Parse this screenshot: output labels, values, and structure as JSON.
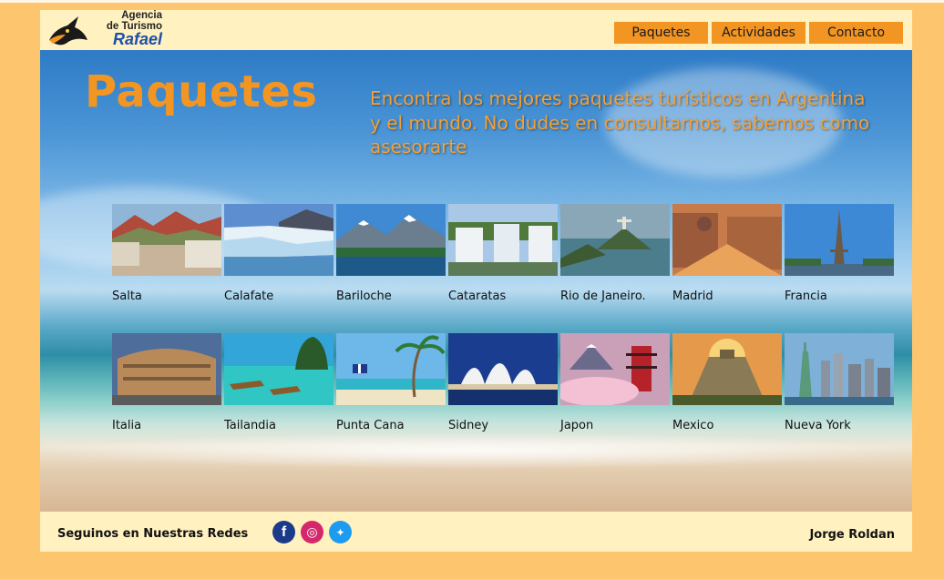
{
  "brand": {
    "line1": "Agencia",
    "line2": "de Turismo",
    "line3": "Rafael"
  },
  "nav": [
    {
      "label": "Paquetes"
    },
    {
      "label": "Actividades"
    },
    {
      "label": "Contacto"
    }
  ],
  "hero": {
    "title": "Paquetes",
    "subtitle": "Encontra los mejores paquetes turísticos en Argentina y el mundo. No dudes en consultarnos, sabemos como asesorarte"
  },
  "destinations": [
    [
      {
        "name": "Salta"
      },
      {
        "name": "Calafate"
      },
      {
        "name": "Bariloche"
      },
      {
        "name": "Cataratas"
      },
      {
        "name": "Rio de Janeiro."
      },
      {
        "name": "Madrid"
      },
      {
        "name": "Francia"
      }
    ],
    [
      {
        "name": "Italia"
      },
      {
        "name": "Tailandia"
      },
      {
        "name": "Punta Cana"
      },
      {
        "name": "Sidney"
      },
      {
        "name": "Japon"
      },
      {
        "name": "Mexico"
      },
      {
        "name": "Nueva York"
      }
    ]
  ],
  "footer": {
    "follow": "Seguinos en Nuestras Redes",
    "socials": [
      {
        "icon": "facebook-icon",
        "glyph": "f",
        "color": "#1c3a8a"
      },
      {
        "icon": "instagram-icon",
        "glyph": "◎",
        "color": "#d4286a"
      },
      {
        "icon": "twitter-icon",
        "glyph": "✦",
        "color": "#1d9bf0"
      }
    ],
    "author": "Jorge Roldan"
  },
  "colors": {
    "accent": "#f39523",
    "background": "#fdc66e",
    "panel": "#fff1c0",
    "brand_blue": "#1f4fa8"
  }
}
